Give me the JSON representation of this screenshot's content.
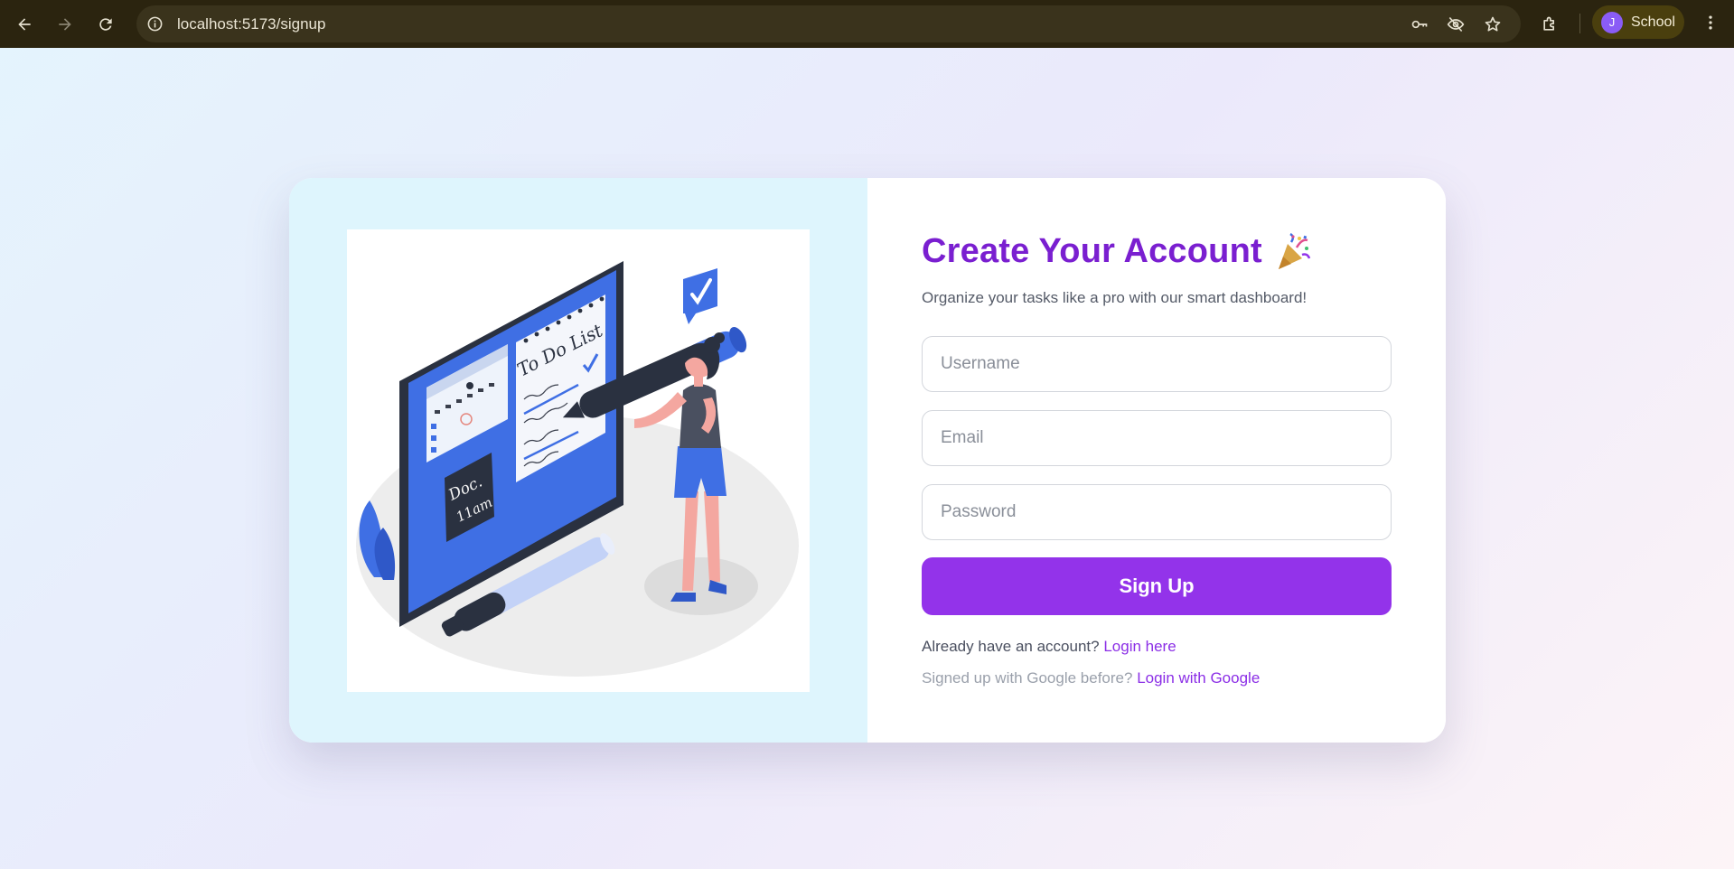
{
  "browser": {
    "url": "localhost:5173/signup",
    "profile_initial": "J",
    "profile_name": "School",
    "icons": [
      "back-icon",
      "forward-icon",
      "reload-icon",
      "info-icon",
      "key-icon",
      "eye-off-icon",
      "star-icon",
      "extensions-icon",
      "menu-icon"
    ]
  },
  "signup": {
    "title": "Create Your Account",
    "title_emoji_icon": "party-popper-icon",
    "subtitle": "Organize your tasks like a pro with our smart dashboard!",
    "username_placeholder": "Username",
    "email_placeholder": "Email",
    "password_placeholder": "Password",
    "button_label": "Sign Up",
    "account_prompt": "Already have an account?",
    "login_link": "Login here",
    "google_prompt": "Signed up with Google before?",
    "google_link": "Login with Google"
  },
  "illustration": {
    "todo_title": "To Do List",
    "note_text_line1": "Doc.",
    "note_text_line2": "11am"
  },
  "colors": {
    "accent": "#9333ea",
    "title": "#7a1fd0",
    "left_panel_bg": "#def5fd",
    "illustration_blue": "#3f6fe4"
  }
}
